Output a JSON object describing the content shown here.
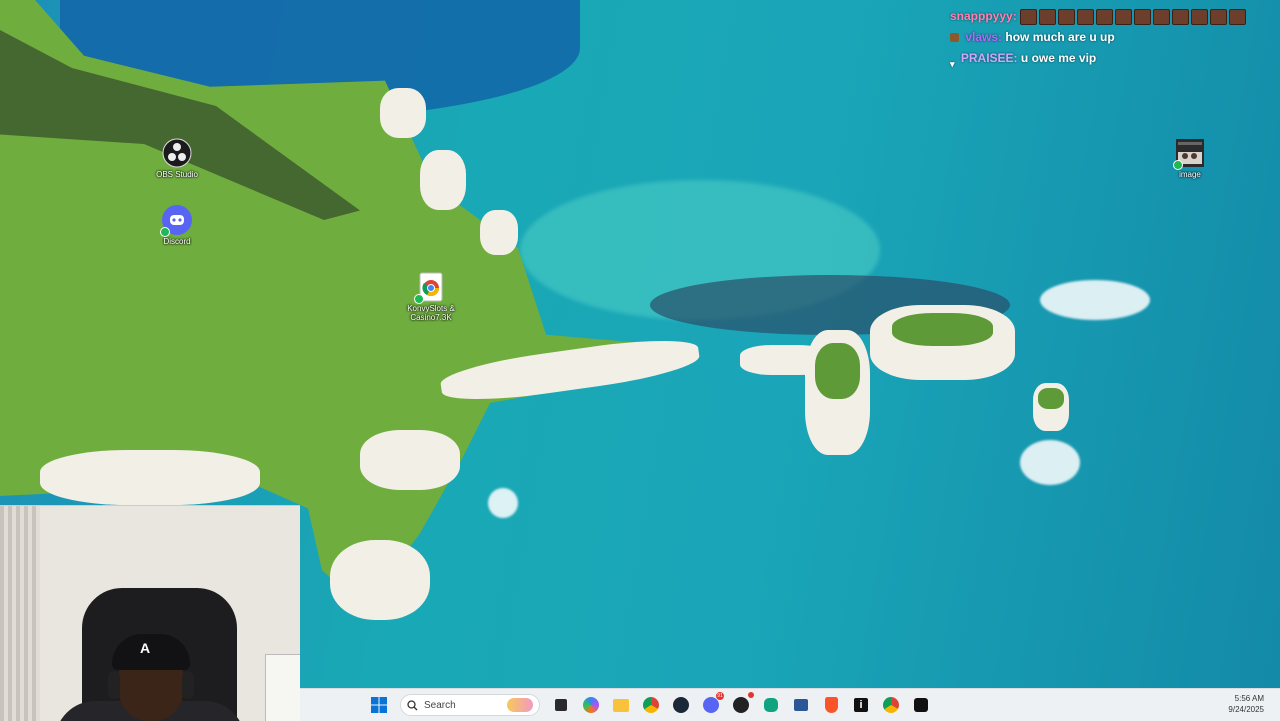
{
  "desktop": {
    "icons": [
      {
        "label": "OBS Studio"
      },
      {
        "label": "Discord"
      },
      {
        "label": "KonvySlots & Casino7.3K"
      },
      {
        "label": "image"
      }
    ]
  },
  "chat": {
    "messages": [
      {
        "user": "snapppyyy:",
        "text": "",
        "user_color": "#ff7fb3",
        "emote_count": 12
      },
      {
        "user": "vlaws:",
        "text": "how much are u up",
        "user_color": "#b068ff"
      },
      {
        "user": "PRAISEE:",
        "text": "u owe me vip",
        "user_color": "#d1a6ff"
      }
    ]
  },
  "taskbar": {
    "search_placeholder": "Search",
    "apps": [
      "start-icon",
      "search",
      "task-view-icon",
      "copilot-icon",
      "file-explorer-icon",
      "chrome-icon",
      "steam-icon",
      "discord-icon",
      "app-icon",
      "chatgpt-icon",
      "powershell-icon",
      "brave-icon",
      "info-icon",
      "chrome-profile-icon",
      "arc-icon"
    ],
    "discord_badge": "91",
    "time": "5:56 AM",
    "date": "9/24/2025"
  }
}
